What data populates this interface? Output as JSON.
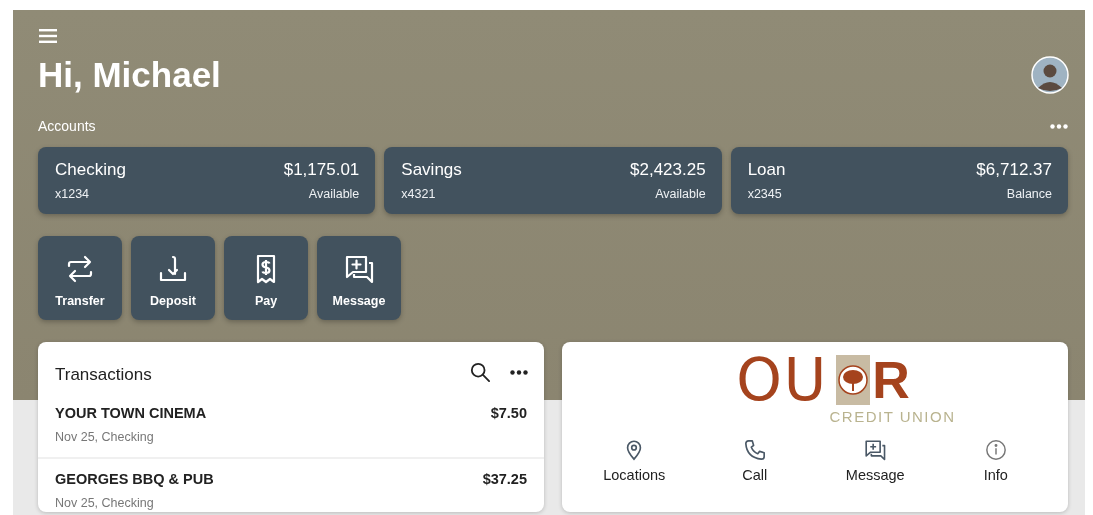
{
  "greeting": "Hi, Michael",
  "accounts": {
    "title": "Accounts",
    "items": [
      {
        "name": "Checking",
        "number": "x1234",
        "amount": "$1,175.01",
        "amount_label": "Available"
      },
      {
        "name": "Savings",
        "number": "x4321",
        "amount": "$2,423.25",
        "amount_label": "Available"
      },
      {
        "name": "Loan",
        "number": "x2345",
        "amount": "$6,712.37",
        "amount_label": "Balance"
      }
    ]
  },
  "actions": [
    {
      "kind": "transfer",
      "label": "Transfer"
    },
    {
      "kind": "deposit",
      "label": "Deposit"
    },
    {
      "kind": "pay",
      "label": "Pay"
    },
    {
      "kind": "message",
      "label": "Message"
    }
  ],
  "transactions": {
    "title": "Transactions",
    "rows": [
      {
        "merchant": "YOUR TOWN CINEMA",
        "detail": "Nov 25, Checking",
        "amount": "$7.50"
      },
      {
        "merchant": "GEORGES BBQ & PUB",
        "detail": "Nov 25, Checking",
        "amount": "$37.25"
      }
    ]
  },
  "logo": {
    "wordmark": "OU",
    "letter": "R",
    "tagline": "CREDIT UNION"
  },
  "contact": [
    {
      "kind": "locations",
      "label": "Locations"
    },
    {
      "kind": "call",
      "label": "Call"
    },
    {
      "kind": "message",
      "label": "Message"
    },
    {
      "kind": "info",
      "label": "Info"
    }
  ]
}
